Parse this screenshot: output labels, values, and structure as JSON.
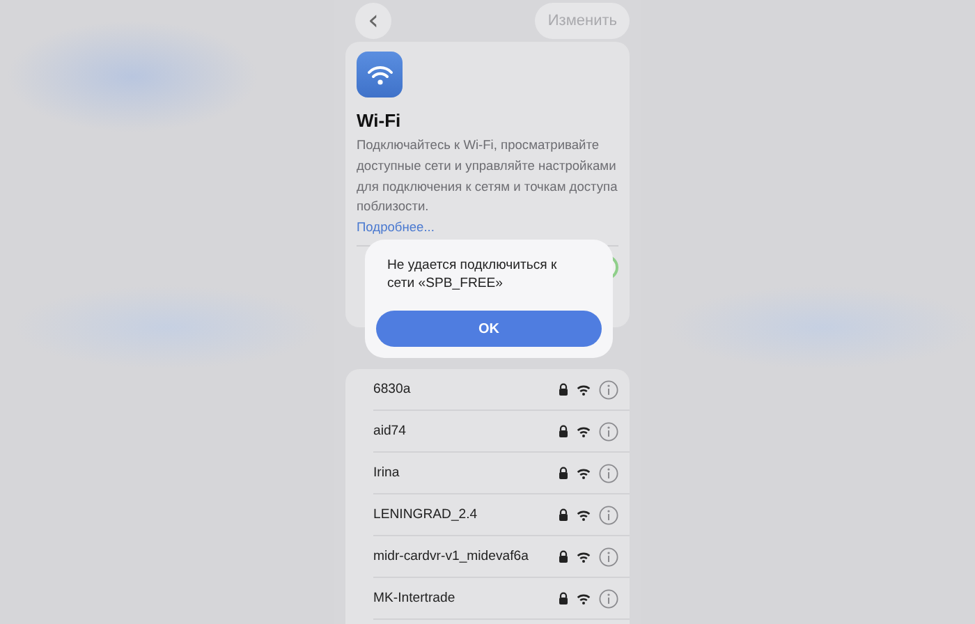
{
  "nav": {
    "back": "‹",
    "edit": "Изменить"
  },
  "header": {
    "title": "Wi-Fi",
    "description": "Подключайтесь к Wi-Fi, просматривайте доступные сети и управляйте настройками для подключения к сетям и точкам доступа поблизости.",
    "link": "Подробнее..."
  },
  "wifi_toggle": {
    "on": true
  },
  "networks": [
    {
      "name": "6830a",
      "locked": true
    },
    {
      "name": "aid74",
      "locked": true
    },
    {
      "name": "Irina",
      "locked": true
    },
    {
      "name": "LENINGRAD_2.4",
      "locked": true
    },
    {
      "name": "midr-cardvr-v1_midevaf6a",
      "locked": true
    },
    {
      "name": "MK-Intertrade",
      "locked": true
    }
  ],
  "alert": {
    "message": "Не удается подключиться к сети «SPB_FREE»",
    "button": "OK"
  }
}
